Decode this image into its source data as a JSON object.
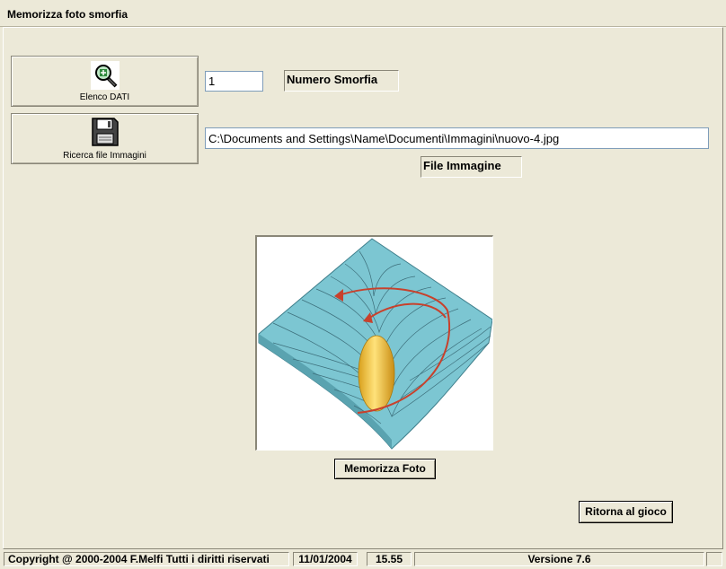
{
  "window": {
    "title": "Memorizza foto smorfia"
  },
  "toolbar": {
    "elenco_label": "Elenco DATI",
    "elenco_icon": "magnifier-icon",
    "ricerca_label": "Ricerca file Immagini",
    "ricerca_icon": "floppy-disk-icon"
  },
  "form": {
    "numero_value": "1",
    "numero_label": "Numero  Smorfia",
    "file_path": "C:\\Documents and Settings\\Name\\Documenti\\Immagini\\nuovo-4.jpg",
    "file_label": "File Immagine"
  },
  "image": {
    "icon": "gravity-well-illustration"
  },
  "buttons": {
    "memorizza": "Memorizza Foto",
    "ritorna": "Ritorna al gioco"
  },
  "status": {
    "copyright": "Copyright @ 2000-2004 F.Melfi Tutti i diritti riservati",
    "date": "11/01/2004",
    "time": "15.55",
    "version": "Versione 7.6"
  },
  "colors": {
    "window_bg": "#ece9d8",
    "surface": "#7cc6d2",
    "egg": "#f0c83c",
    "arrow": "#c8412c"
  }
}
